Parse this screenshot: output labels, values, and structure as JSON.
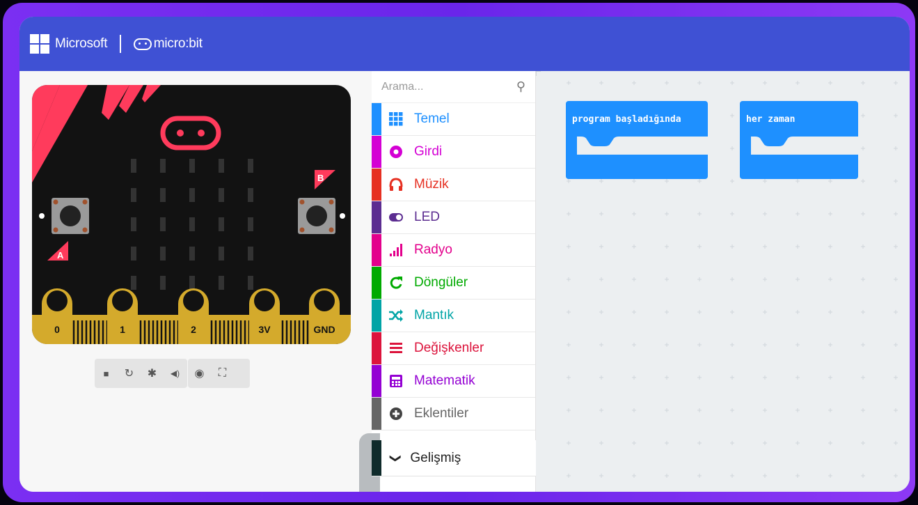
{
  "header": {
    "microsoft_label": "Microsoft",
    "microbit_label": "micro:bit"
  },
  "simulator": {
    "button_a": "A",
    "button_b": "B",
    "pins": [
      "0",
      "1",
      "2",
      "3V",
      "GND"
    ],
    "controls": [
      {
        "name": "stop",
        "icon": "■"
      },
      {
        "name": "restart",
        "icon": "↻"
      },
      {
        "name": "debug",
        "icon": "✱"
      },
      {
        "name": "mute",
        "icon": "◀)"
      },
      {
        "name": "screenshot",
        "icon": "◉"
      },
      {
        "name": "fullscreen",
        "icon": "⛶"
      }
    ]
  },
  "toolbox": {
    "search_placeholder": "Arama...",
    "categories": [
      {
        "label": "Temel",
        "color": "#1e90ff"
      },
      {
        "label": "Girdi",
        "color": "#d400d4"
      },
      {
        "label": "Müzik",
        "color": "#e63022"
      },
      {
        "label": "LED",
        "color": "#5c2d91"
      },
      {
        "label": "Radyo",
        "color": "#e3008c"
      },
      {
        "label": "Döngüler",
        "color": "#00aa00"
      },
      {
        "label": "Mantık",
        "color": "#00a4a6"
      },
      {
        "label": "Değişkenler",
        "color": "#dc143c"
      },
      {
        "label": "Matematik",
        "color": "#9400d3"
      },
      {
        "label": "Eklentiler",
        "color": "#666666"
      }
    ],
    "advanced_label": "Gelişmiş"
  },
  "workspace": {
    "blocks": [
      {
        "label": "program başladığında"
      },
      {
        "label": "her zaman"
      }
    ]
  },
  "colors": {
    "header_bg": "#3f51d4",
    "frame": "#7b2ff2",
    "block": "#1e90ff",
    "board_red": "#ff3b5c",
    "board_gold": "#d4aa2c"
  }
}
